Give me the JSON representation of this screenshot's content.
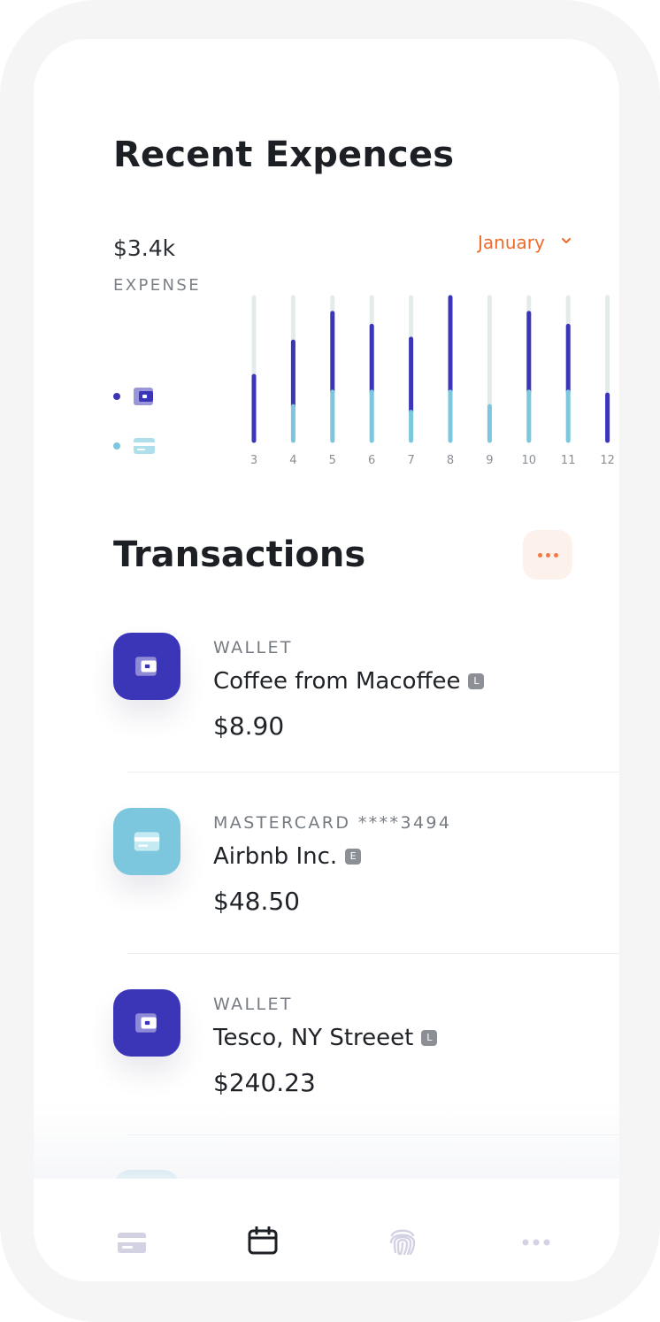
{
  "header": {
    "title": "Recent Expences"
  },
  "summary": {
    "amount": "$3.4k",
    "label": "EXPENSE",
    "month": "January"
  },
  "legend": [
    {
      "icon": "wallet-icon",
      "color": "#3b35b8"
    },
    {
      "icon": "credit-card-icon",
      "color": "#7dc7de"
    }
  ],
  "colors": {
    "wallet": "#3b35b8",
    "card": "#7dc7de",
    "track": "#e4eceb",
    "accent": "#ef6b2c"
  },
  "chart_data": {
    "type": "bar",
    "categories": [
      "3",
      "4",
      "5",
      "6",
      "7",
      "8",
      "9",
      "10",
      "11",
      "12"
    ],
    "series": [
      {
        "values": [
          45,
          45,
          55,
          46,
          51,
          66,
          0,
          55,
          46,
          32
        ]
      },
      {
        "values": [
          0,
          24,
          34,
          34,
          20,
          34,
          24,
          34,
          34,
          0
        ]
      }
    ],
    "ylim": [
      0,
      100
    ]
  },
  "transactions": {
    "title": "Transactions",
    "items": [
      {
        "source": "WALLET",
        "name": "Coffee from Macoffee",
        "tag": "L",
        "amount": "$8.90",
        "icon": "wallet-icon"
      },
      {
        "source": "MASTERCARD ****3494",
        "name": "Airbnb Inc.",
        "tag": "E",
        "amount": "$48.50",
        "icon": "credit-card-icon"
      },
      {
        "source": "WALLET",
        "name": "Tesco, NY Streeet",
        "tag": "L",
        "amount": "$240.23",
        "icon": "wallet-icon"
      }
    ]
  },
  "nav": [
    {
      "icon": "credit-card-icon",
      "active": false
    },
    {
      "icon": "calendar-icon",
      "active": true
    },
    {
      "icon": "fingerprint-icon",
      "active": false
    },
    {
      "icon": "more-horizontal-icon",
      "active": false
    }
  ]
}
